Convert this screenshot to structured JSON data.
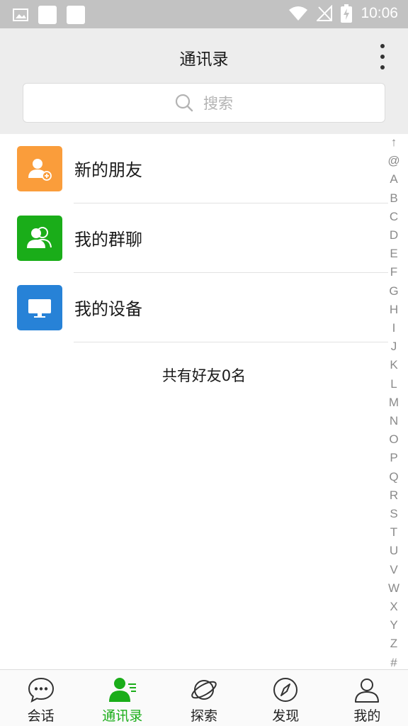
{
  "status_bar": {
    "time": "10:06",
    "icons": [
      "image-icon",
      "notification-box-icon",
      "notification-box-icon",
      "wifi-icon",
      "no-signal-icon",
      "battery-charging-icon"
    ]
  },
  "header": {
    "title": "通讯录",
    "more_icon": "more-vertical-icon"
  },
  "search": {
    "placeholder": "搜索",
    "icon": "search-icon"
  },
  "contacts_menu": [
    {
      "label": "新的朋友",
      "icon": "add-friend-icon",
      "color": "#fa9d3b"
    },
    {
      "label": "我的群聊",
      "icon": "group-icon",
      "color": "#1aad19"
    },
    {
      "label": "我的设备",
      "icon": "device-icon",
      "color": "#2782d7"
    }
  ],
  "friend_count_text": "共有好友0名",
  "index_bar": [
    "↑",
    "@",
    "A",
    "B",
    "C",
    "D",
    "E",
    "F",
    "G",
    "H",
    "I",
    "J",
    "K",
    "L",
    "M",
    "N",
    "O",
    "P",
    "Q",
    "R",
    "S",
    "T",
    "U",
    "V",
    "W",
    "X",
    "Y",
    "Z",
    "#"
  ],
  "tabs": [
    {
      "label": "会话",
      "icon": "chat-bubble-icon",
      "active": false
    },
    {
      "label": "通讯录",
      "icon": "contacts-icon",
      "active": true
    },
    {
      "label": "探索",
      "icon": "planet-icon",
      "active": false
    },
    {
      "label": "发现",
      "icon": "compass-icon",
      "active": false
    },
    {
      "label": "我的",
      "icon": "profile-icon",
      "active": false
    }
  ],
  "colors": {
    "accent": "#1aad19",
    "status_bar": "#c2c2c2",
    "header_bg": "#ededed"
  }
}
